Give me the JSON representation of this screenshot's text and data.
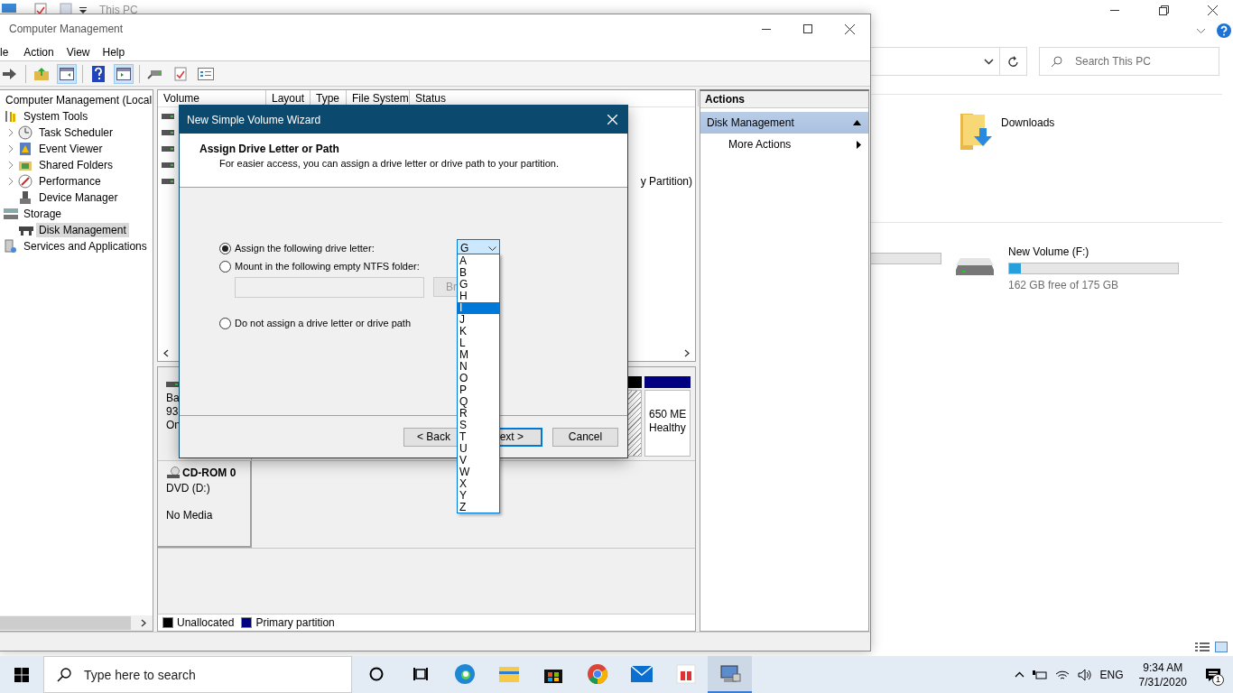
{
  "explorer": {
    "title": "This PC",
    "search": {
      "placeholder": "Search This PC"
    },
    "folders": [
      {
        "label": "Downloads"
      }
    ],
    "drives": [
      {
        "label": "New Volume (F:)",
        "level": 0.07,
        "free": "162 GB free of 175 GB"
      }
    ]
  },
  "computer_management": {
    "title": "Computer Management",
    "menu": [
      "le",
      "Action",
      "View",
      "Help"
    ],
    "tree": [
      {
        "label": "Computer Management (Local",
        "selected": false,
        "children": [
          {
            "label": "System Tools",
            "selected": false,
            "children": [
              {
                "label": "Task Scheduler",
                "selected": false,
                "expandable": true
              },
              {
                "label": "Event Viewer",
                "selected": false,
                "expandable": true
              },
              {
                "label": "Shared Folders",
                "selected": false,
                "expandable": true
              },
              {
                "label": "Performance",
                "selected": false,
                "expandable": true
              },
              {
                "label": "Device Manager",
                "selected": false,
                "expandable": false
              }
            ]
          },
          {
            "label": "Storage",
            "selected": false,
            "children": [
              {
                "label": "Disk Management",
                "selected": true,
                "expandable": false
              }
            ]
          },
          {
            "label": "Services and Applications",
            "selected": false
          }
        ]
      }
    ],
    "columns": [
      "Volume",
      "Layout",
      "Type",
      "File System",
      "Status"
    ],
    "status_fragment": "y Partition)",
    "disk": {
      "lines": [
        "Ba",
        "93",
        "On"
      ],
      "partitions": [
        {
          "kind": "unallocated"
        },
        {
          "kind": "primary",
          "lines": [
            "650 ME",
            "Healthy"
          ]
        }
      ]
    },
    "cdrom": {
      "name": "CD-ROM 0",
      "type": "DVD (D:)",
      "status": "No Media"
    },
    "legend": [
      {
        "label": "Unallocated",
        "color": "#000000"
      },
      {
        "label": "Primary partition",
        "color": "#000080"
      }
    ],
    "actions": {
      "title": "Actions",
      "items": [
        {
          "label": "Disk Management",
          "kind": "header"
        },
        {
          "label": "More Actions",
          "kind": "submenu"
        }
      ]
    }
  },
  "wizard": {
    "title": "New Simple Volume Wizard",
    "heading": "Assign Drive Letter or Path",
    "subtitle": "For easier access, you can assign a drive letter or drive path to your partition.",
    "options": [
      {
        "label": "Assign the following drive letter:",
        "selected": true
      },
      {
        "label": "Mount in the following empty NTFS folder:",
        "selected": false
      },
      {
        "label": "Do not assign a drive letter or drive path",
        "selected": false
      }
    ],
    "browse": "Br",
    "drive_letter": "G",
    "letters": [
      {
        "label": "A",
        "selected": false
      },
      {
        "label": "B",
        "selected": false
      },
      {
        "label": "G",
        "selected": false
      },
      {
        "label": "H",
        "selected": false
      },
      {
        "label": "I",
        "selected": true
      },
      {
        "label": "J",
        "selected": false
      },
      {
        "label": "K",
        "selected": false
      },
      {
        "label": "L",
        "selected": false
      },
      {
        "label": "M",
        "selected": false
      },
      {
        "label": "N",
        "selected": false
      },
      {
        "label": "O",
        "selected": false
      },
      {
        "label": "P",
        "selected": false
      },
      {
        "label": "Q",
        "selected": false
      },
      {
        "label": "R",
        "selected": false
      },
      {
        "label": "S",
        "selected": false
      },
      {
        "label": "T",
        "selected": false
      },
      {
        "label": "U",
        "selected": false
      },
      {
        "label": "V",
        "selected": false
      },
      {
        "label": "W",
        "selected": false
      },
      {
        "label": "X",
        "selected": false
      },
      {
        "label": "Y",
        "selected": false
      },
      {
        "label": "Z",
        "selected": false
      }
    ],
    "buttons": [
      {
        "label": "< Back",
        "default": false
      },
      {
        "label": "ext >",
        "default": true
      },
      {
        "label": "Cancel",
        "default": false
      }
    ]
  },
  "taskbar": {
    "search": {
      "placeholder": "Type here to search"
    },
    "apps": [
      {
        "selected": false
      },
      {
        "selected": false
      },
      {
        "selected": false
      },
      {
        "selected": false
      },
      {
        "selected": false
      },
      {
        "selected": false
      },
      {
        "selected": false
      },
      {
        "selected": false
      },
      {
        "selected": true
      }
    ],
    "language": "ENG",
    "time": "9:34 AM",
    "date": "7/31/2020",
    "notifications": "1"
  }
}
